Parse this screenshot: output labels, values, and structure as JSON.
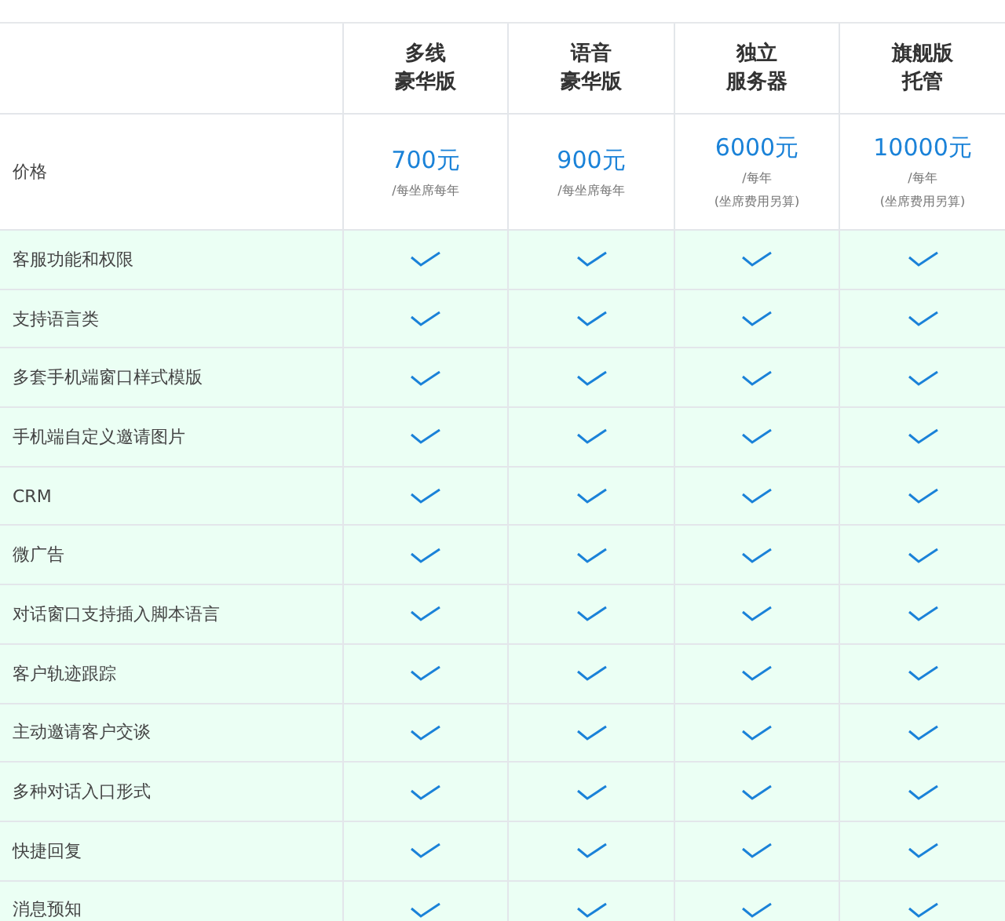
{
  "plans": [
    {
      "name_lines": [
        "多线",
        "豪华版"
      ]
    },
    {
      "name_lines": [
        "语音",
        "豪华版"
      ]
    },
    {
      "name_lines": [
        "独立",
        "服务器"
      ]
    },
    {
      "name_lines": [
        "旗舰版",
        "托管"
      ]
    }
  ],
  "price_row": {
    "label": "价格",
    "prices": [
      {
        "amount": "700元",
        "notes": [
          "/每坐席每年"
        ]
      },
      {
        "amount": "900元",
        "notes": [
          "/每坐席每年"
        ]
      },
      {
        "amount": "6000元",
        "notes": [
          "/每年",
          "(坐席费用另算)"
        ]
      },
      {
        "amount": "10000元",
        "notes": [
          "/每年",
          "(坐席费用另算)"
        ]
      }
    ]
  },
  "features": [
    {
      "label": "客服功能和权限",
      "checks": [
        true,
        true,
        true,
        true
      ]
    },
    {
      "label": "支持语言类",
      "checks": [
        true,
        true,
        true,
        true
      ]
    },
    {
      "label": "多套手机端窗口样式模版",
      "checks": [
        true,
        true,
        true,
        true
      ]
    },
    {
      "label": "手机端自定义邀请图片",
      "checks": [
        true,
        true,
        true,
        true
      ]
    },
    {
      "label": "CRM",
      "checks": [
        true,
        true,
        true,
        true
      ]
    },
    {
      "label": "微广告",
      "checks": [
        true,
        true,
        true,
        true
      ]
    },
    {
      "label": "对话窗口支持插入脚本语言",
      "checks": [
        true,
        true,
        true,
        true
      ]
    },
    {
      "label": "客户轨迹跟踪",
      "checks": [
        true,
        true,
        true,
        true
      ]
    },
    {
      "label": "主动邀请客户交谈",
      "checks": [
        true,
        true,
        true,
        true
      ]
    },
    {
      "label": "多种对话入口形式",
      "checks": [
        true,
        true,
        true,
        true
      ]
    },
    {
      "label": "快捷回复",
      "checks": [
        true,
        true,
        true,
        true
      ]
    },
    {
      "label": "消息预知",
      "checks": [
        true,
        true,
        true,
        true
      ]
    }
  ]
}
